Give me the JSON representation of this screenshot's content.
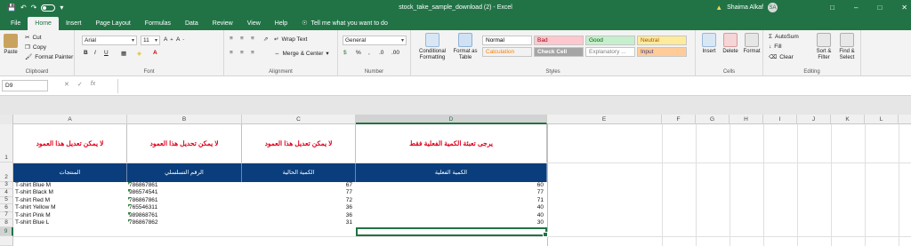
{
  "titlebar": {
    "filename": "stock_take_sample_download (2)  -  Excel",
    "user_name": "Shaima Alkaf",
    "user_initials": "SA",
    "save_icon": "save-icon",
    "undo_icon": "undo-icon",
    "redo_icon": "redo-icon"
  },
  "menu": {
    "tabs": [
      "File",
      "Home",
      "Insert",
      "Page Layout",
      "Formulas",
      "Data",
      "Review",
      "View",
      "Help"
    ],
    "active": "Home",
    "tell_me": "Tell me what you want to do"
  },
  "ribbon": {
    "clipboard": {
      "paste": "Paste",
      "cut": "Cut",
      "copy": "Copy",
      "format_painter": "Format Painter",
      "label": "Clipboard"
    },
    "font": {
      "name": "Arial",
      "size": "11",
      "label": "Font"
    },
    "alignment": {
      "wrap": "Wrap Text",
      "merge": "Merge & Center",
      "label": "Alignment"
    },
    "number": {
      "format": "General",
      "label": "Number"
    },
    "styles": {
      "conditional": "Conditional Formatting",
      "format_table": "Format as Table",
      "cells": [
        {
          "label": "Normal",
          "bg": "#ffffff",
          "color": "#000000"
        },
        {
          "label": "Bad",
          "bg": "#ffc7ce",
          "color": "#9c0006"
        },
        {
          "label": "Good",
          "bg": "#c6efce",
          "color": "#006100"
        },
        {
          "label": "Neutral",
          "bg": "#ffeb9c",
          "color": "#9c5700"
        },
        {
          "label": "Calculation",
          "bg": "#f2f2f2",
          "color": "#fa7d00"
        },
        {
          "label": "Check Cell",
          "bg": "#a5a5a5",
          "color": "#ffffff"
        },
        {
          "label": "Explanatory ...",
          "bg": "#ffffff",
          "color": "#7f7f7f"
        },
        {
          "label": "Input",
          "bg": "#ffcc99",
          "color": "#3f3f76"
        }
      ],
      "label": "Styles"
    },
    "cells": {
      "insert": "Insert",
      "delete": "Delete",
      "format": "Format",
      "label": "Cells"
    },
    "editing": {
      "autosum": "AutoSum",
      "fill": "Fill",
      "clear": "Clear",
      "sort": "Sort & Filter",
      "find": "Find & Select",
      "label": "Editing"
    }
  },
  "formula_bar": {
    "name_box": "D9",
    "value": ""
  },
  "sheet": {
    "columns": [
      "A",
      "B",
      "C",
      "D",
      "E",
      "F",
      "G",
      "H",
      "I",
      "J",
      "K",
      "L"
    ],
    "selected_column": "D",
    "rows": [
      "1",
      "2",
      "3",
      "4",
      "5",
      "6",
      "7",
      "8",
      "9"
    ],
    "selected_row": "9",
    "notes": {
      "a": "لا يمكن تعديل هذا العمود",
      "b": "لا يمكن تحديل هذا العمود",
      "c": "لا يمكن تعديل هذا العمود",
      "d": "يرجى تعبئة الكمية الفعلية فقط"
    },
    "headers": {
      "a": "المنتجات",
      "b": "الرقم التسلسلي",
      "c": "الكمية الحالية",
      "d": "الكمية الفعلية"
    },
    "data": [
      {
        "product": "T-shirt Blue M",
        "serial": "786867861",
        "current": "67",
        "actual": "60"
      },
      {
        "product": "T-shirt Black M",
        "serial": "986574541",
        "current": "77",
        "actual": "77"
      },
      {
        "product": "T-shirt Red M",
        "serial": "786867861",
        "current": "72",
        "actual": "71"
      },
      {
        "product": "T-shirt Yellow M",
        "serial": "765546311",
        "current": "36",
        "actual": "40"
      },
      {
        "product": "T-shirt Pink M",
        "serial": "989868761",
        "current": "36",
        "actual": "40"
      },
      {
        "product": "T-shirt Blue L",
        "serial": "786867862",
        "current": "31",
        "actual": "30"
      }
    ]
  }
}
